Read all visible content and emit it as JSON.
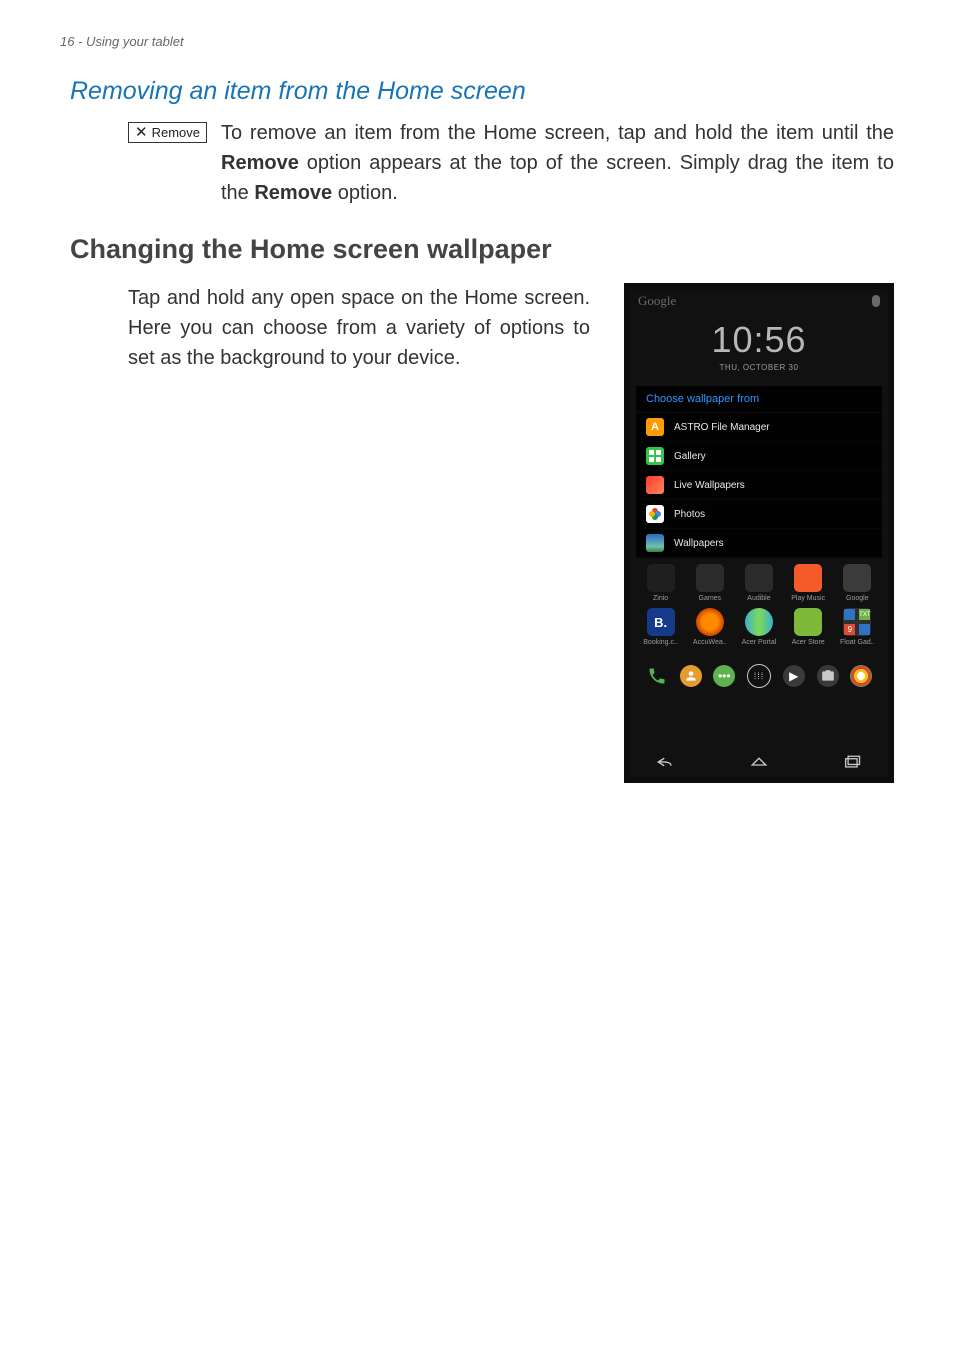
{
  "header": {
    "page_number": "16",
    "section_title": "Using your tablet"
  },
  "subheading": "Removing an item from the Home screen",
  "remove_badge_label": "Remove",
  "remove_paragraph": {
    "part1": "To remove an item from the Home screen, tap and hold the item until the ",
    "bold1": "Remove",
    "part2": " option appears at the top of the screen. Simply drag the item to the ",
    "bold2": "Remove",
    "part3": " option."
  },
  "section_heading": "Changing the Home screen wallpaper",
  "wallpaper_paragraph": "Tap and hold any open space on the Home screen. Here you can choose from a variety of options to set as the background to your device.",
  "device": {
    "google_label": "Google",
    "clock_time": "10:56",
    "clock_date": "THU, OCTOBER 30",
    "wallpaper_dialog_title": "Choose wallpaper from",
    "wallpaper_options": [
      "ASTRO File Manager",
      "Gallery",
      "Live Wallpapers",
      "Photos",
      "Wallpapers"
    ],
    "app_row1": [
      "Zinio",
      "Games",
      "Audible",
      "Play Music",
      "Google"
    ],
    "app_row2": [
      "Booking.c..",
      "AccuWea..",
      "Acer Portal",
      "Acer Store",
      "Float Gad.."
    ]
  }
}
